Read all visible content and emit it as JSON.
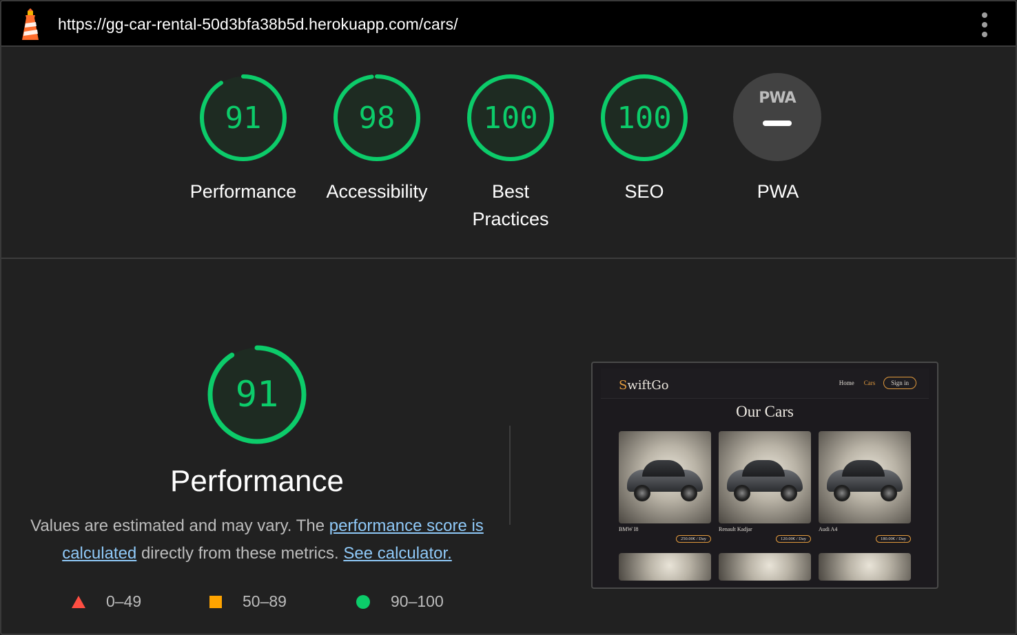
{
  "topbar": {
    "url": "https://gg-car-rental-50d3bfa38b5d.herokuapp.com/cars/"
  },
  "colors": {
    "pass": "#0ccc6a",
    "average": "#ffa400",
    "fail": "#ff4e42",
    "link": "#90caf9"
  },
  "summary": {
    "gauges": [
      {
        "score": 91,
        "label": "Performance"
      },
      {
        "score": 98,
        "label": "Accessibility"
      },
      {
        "score": 100,
        "label": "Best Practices"
      },
      {
        "score": 100,
        "label": "SEO"
      },
      {
        "score": null,
        "label": "PWA",
        "badge_text": "PWA"
      }
    ]
  },
  "performance": {
    "score": 91,
    "title": "Performance",
    "desc_prefix": "Values are estimated and may vary. The ",
    "link1": "performance score is calculated",
    "desc_middle": " directly from these metrics. ",
    "link2": "See calculator.",
    "legend": [
      {
        "range": "0–49",
        "icon": "triangle-icon"
      },
      {
        "range": "50–89",
        "icon": "square-icon"
      },
      {
        "range": "90–100",
        "icon": "circle-icon"
      }
    ]
  },
  "thumbnail": {
    "brand_first": "S",
    "brand_rest": "wiftGo",
    "nav": [
      "Home",
      "Cars"
    ],
    "signin": "Sign in",
    "title": "Our Cars",
    "cars": [
      {
        "name": "BMW I8",
        "price": "250.00€ / Day"
      },
      {
        "name": "Renault Kadjar",
        "price": "120.00€ / Day"
      },
      {
        "name": "Audi A4",
        "price": "180.00€ / Day"
      }
    ]
  }
}
